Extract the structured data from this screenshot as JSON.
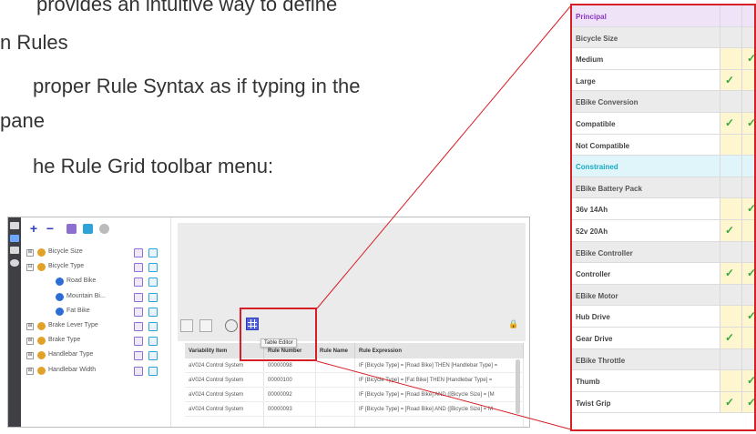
{
  "slide": {
    "line1": "provides an intuitive way to define",
    "line2": "n Rules",
    "line3": "proper Rule Syntax as if typing in the",
    "line4": "pane",
    "line5": "he Rule Grid toolbar menu:"
  },
  "toolbar": {
    "add_symbol": "+",
    "remove_symbol": "−"
  },
  "tree": {
    "items": [
      {
        "label": "Bicycle Size",
        "expander": "⊞",
        "level": 0
      },
      {
        "label": "Bicycle Type",
        "expander": "⊟",
        "level": 0
      },
      {
        "label": "Road Bike",
        "expander": "",
        "level": 1
      },
      {
        "label": "Mountain Bi...",
        "expander": "",
        "level": 1
      },
      {
        "label": "Fat Bike",
        "expander": "",
        "level": 1
      },
      {
        "label": "Brake Lever Type",
        "expander": "⊞",
        "level": 0
      },
      {
        "label": "Brake Type",
        "expander": "⊞",
        "level": 0
      },
      {
        "label": "Handlebar Type",
        "expander": "⊞",
        "level": 0
      },
      {
        "label": "Handlebar Width",
        "expander": "⊞",
        "level": 0
      }
    ]
  },
  "grid": {
    "columns": [
      "Variability Item",
      "Rule Number",
      "Rule Name",
      "Rule Expression"
    ],
    "rows": [
      [
        "aV024 Control System",
        "00000098",
        "",
        "IF [Bicycle Type] = [Road Bike] THEN [Handlebar Type] ="
      ],
      [
        "aV024 Control System",
        "00000100",
        "",
        "IF [Bicycle Type] = [Fat Bike] THEN [Handlebar Type] ="
      ],
      [
        "aV024 Control System",
        "00000092",
        "",
        "IF [Bicycle Type] = [Road Bike] AND ([Bicycle Size] = [M"
      ],
      [
        "aV024 Control System",
        "00000093",
        "",
        "IF [Bicycle Type] = [Road Bike] AND ([Bicycle Size] = M"
      ],
      [
        "",
        "",
        "",
        ""
      ]
    ],
    "tooltip": "Table Editor"
  },
  "table_editor": {
    "rows": [
      {
        "label": "Principal",
        "style": "principal",
        "c1": "",
        "c2": ""
      },
      {
        "label": "Bicycle Size",
        "style": "header",
        "c1": "",
        "c2": ""
      },
      {
        "label": "Medium",
        "style": "normal",
        "c1": "",
        "c2": "✓"
      },
      {
        "label": "Large",
        "style": "normal",
        "c1": "✓",
        "c2": ""
      },
      {
        "label": "EBike Conversion",
        "style": "header",
        "c1": "",
        "c2": ""
      },
      {
        "label": "Compatible",
        "style": "normal",
        "c1": "✓",
        "c2": "✓"
      },
      {
        "label": "Not Compatible",
        "style": "normal",
        "c1": "",
        "c2": ""
      },
      {
        "label": "Constrained",
        "style": "constrained",
        "c1": "",
        "c2": ""
      },
      {
        "label": "EBike Battery Pack",
        "style": "header",
        "c1": "",
        "c2": ""
      },
      {
        "label": "36v 14Ah",
        "style": "normal",
        "c1": "",
        "c2": "✓"
      },
      {
        "label": "52v 20Ah",
        "style": "normal",
        "c1": "✓",
        "c2": ""
      },
      {
        "label": "EBike Controller",
        "style": "header",
        "c1": "",
        "c2": ""
      },
      {
        "label": "Controller",
        "style": "normal",
        "c1": "✓",
        "c2": "✓"
      },
      {
        "label": "EBike Motor",
        "style": "header",
        "c1": "",
        "c2": ""
      },
      {
        "label": "Hub Drive",
        "style": "normal",
        "c1": "",
        "c2": "✓"
      },
      {
        "label": "Gear Drive",
        "style": "normal",
        "c1": "✓",
        "c2": ""
      },
      {
        "label": "EBike Throttle",
        "style": "header",
        "c1": "",
        "c2": ""
      },
      {
        "label": "Thumb",
        "style": "normal",
        "c1": "",
        "c2": "✓"
      },
      {
        "label": "Twist Grip",
        "style": "normal",
        "c1": "✓",
        "c2": "✓"
      }
    ]
  },
  "colors": {
    "accent_red": "#d61f26",
    "principal_purple": "#8a35c2",
    "constrained_cyan": "#1aa8c5",
    "check_green": "#3aa83a",
    "cell_yellow": "#fdf6cf"
  }
}
